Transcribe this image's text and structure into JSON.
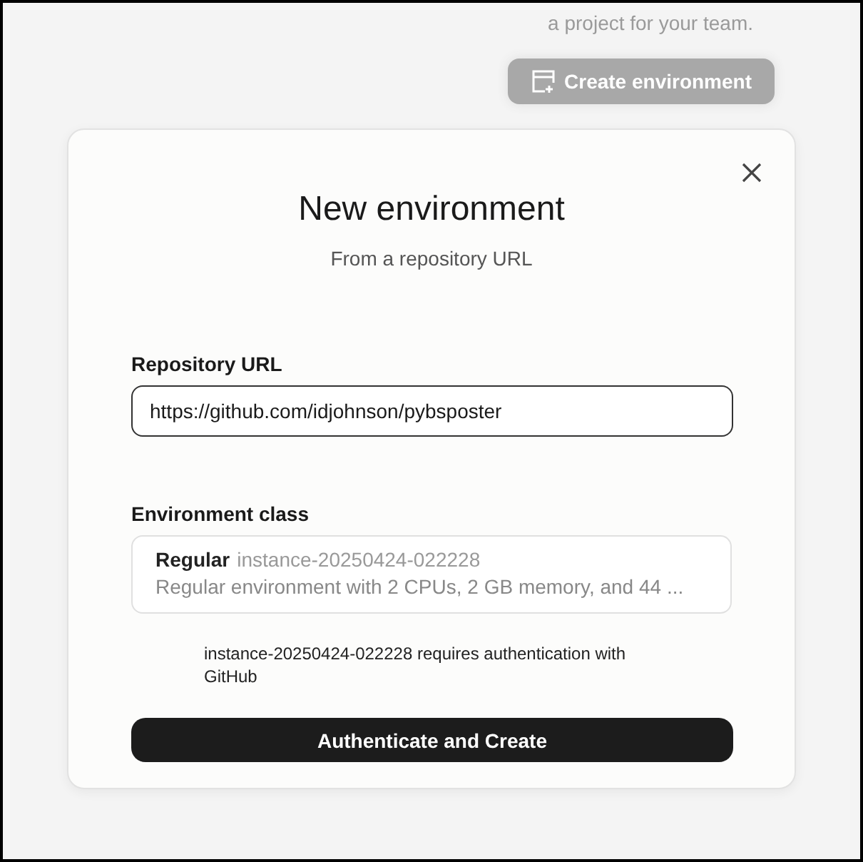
{
  "background": {
    "subtitle": "a project for your team.",
    "create_button": "Create environment"
  },
  "dialog": {
    "title": "New environment",
    "subtitle": "From a repository URL",
    "repository": {
      "label": "Repository URL",
      "value": "https://github.com/idjohnson/pybsposter"
    },
    "environment_class": {
      "label": "Environment class",
      "name": "Regular",
      "instance": "instance-20250424-022228",
      "description": "Regular environment with 2 CPUs, 2 GB memory, and 44 ..."
    },
    "notice": {
      "instance": "instance-20250424-022228",
      "text": "requires authentication with GitHub"
    },
    "submit": "Authenticate and Create"
  }
}
